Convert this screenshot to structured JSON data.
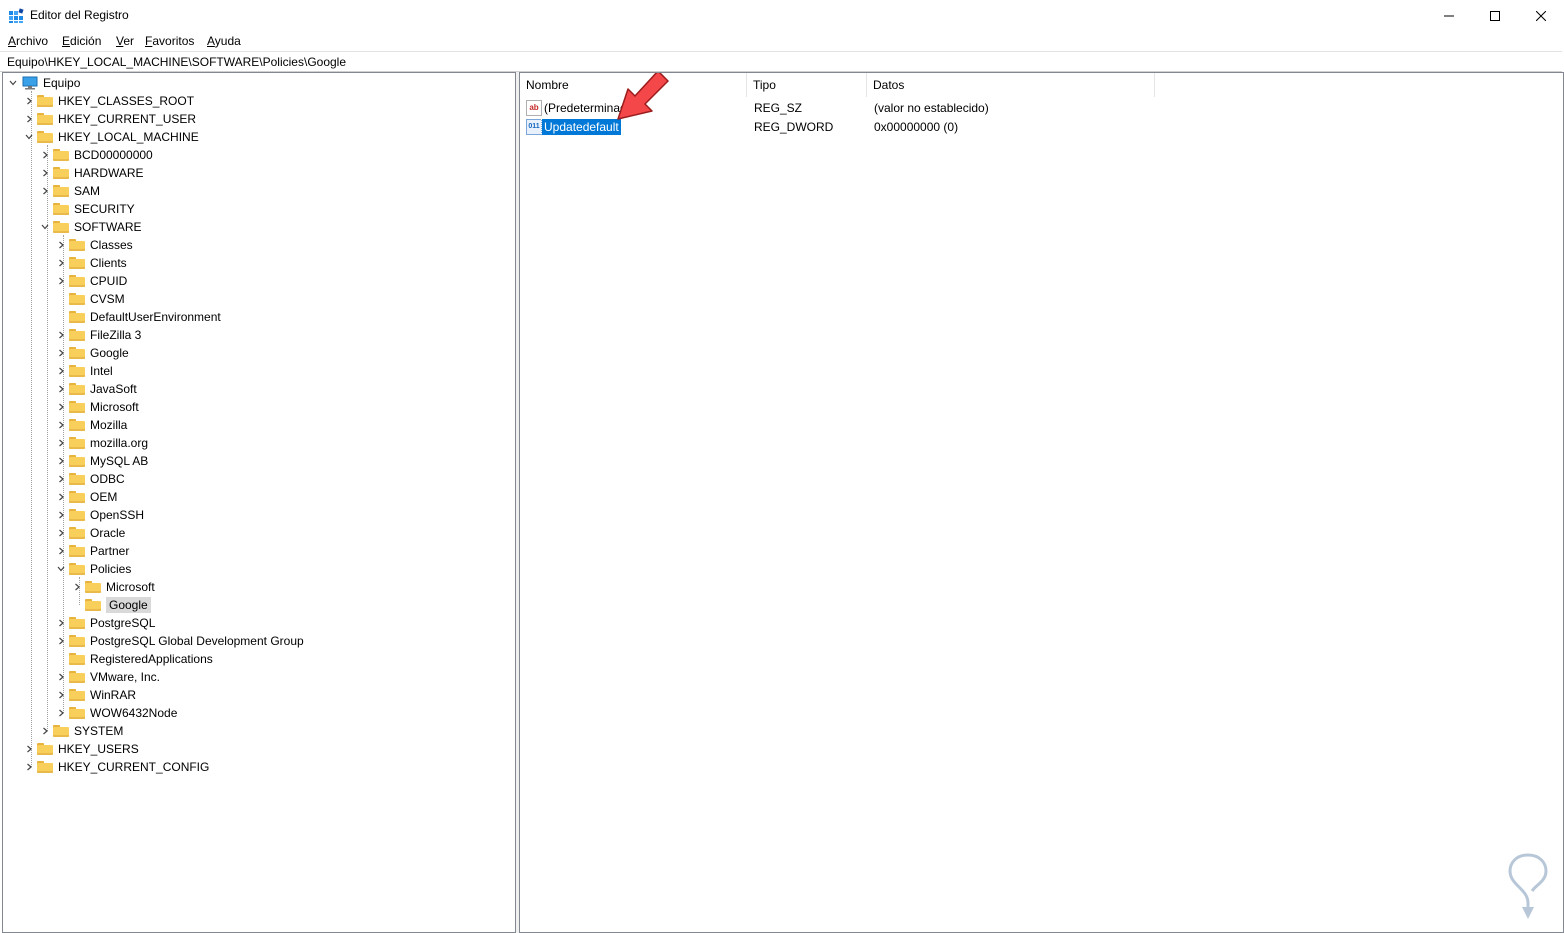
{
  "window": {
    "title": "Editor del Registro",
    "minimize": "—",
    "maximize": "☐",
    "close": "✕"
  },
  "menu": [
    {
      "accel": "A",
      "rest": "rchivo"
    },
    {
      "accel": "E",
      "rest": "dición"
    },
    {
      "accel": "V",
      "rest": "er"
    },
    {
      "accel": "F",
      "rest": "avoritos"
    },
    {
      "accel": "A",
      "rest": "yuda"
    }
  ],
  "address": "Equipo\\HKEY_LOCAL_MACHINE\\SOFTWARE\\Policies\\Google",
  "tree": {
    "root": "Equipo",
    "hkcr": "HKEY_CLASSES_ROOT",
    "hkcu": "HKEY_CURRENT_USER",
    "hklm": "HKEY_LOCAL_MACHINE",
    "hklm_children": [
      "BCD00000000",
      "HARDWARE",
      "SAM",
      "SECURITY",
      "SOFTWARE"
    ],
    "software_children": [
      "Classes",
      "Clients",
      "CPUID",
      "CVSM",
      "DefaultUserEnvironment",
      "FileZilla 3",
      "Google",
      "Intel",
      "JavaSoft",
      "Microsoft",
      "Mozilla",
      "mozilla.org",
      "MySQL AB",
      "ODBC",
      "OEM",
      "OpenSSH",
      "Oracle",
      "Partner",
      "Policies"
    ],
    "policies_children": [
      "Microsoft",
      "Google"
    ],
    "software_after": [
      "PostgreSQL",
      "PostgreSQL Global Development Group",
      "RegisteredApplications",
      "VMware, Inc.",
      "WinRAR",
      "WOW6432Node"
    ],
    "system": "SYSTEM",
    "hku": "HKEY_USERS",
    "hkcc": "HKEY_CURRENT_CONFIG"
  },
  "columns": {
    "name": "Nombre",
    "type": "Tipo",
    "data": "Datos"
  },
  "values": [
    {
      "name": "(Predeterminado)",
      "type": "REG_SZ",
      "data": "(valor no establecido)",
      "icon": "ab"
    },
    {
      "name": "Updatedefault",
      "type": "REG_DWORD",
      "data": "0x00000000 (0)",
      "icon": "011"
    }
  ],
  "colors": {
    "selection": "#0078d7",
    "folder": "#f8cf5b",
    "arrow": "#f4474a"
  }
}
